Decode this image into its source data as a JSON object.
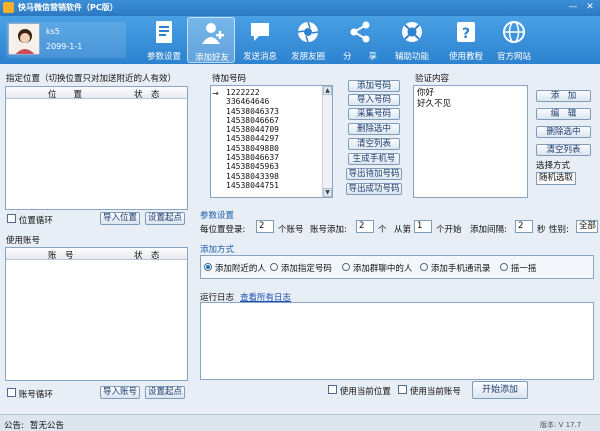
{
  "window": {
    "title": "快马微信营销软件（PC版）",
    "minimize": "—",
    "close": "✕"
  },
  "user": {
    "name": "ks5",
    "date": "2099-1-1"
  },
  "nav": [
    {
      "label": "参数设置",
      "icon": "document-icon"
    },
    {
      "label": "添加好友",
      "icon": "add-user-icon"
    },
    {
      "label": "发送消息",
      "icon": "chat-bubble-icon"
    },
    {
      "label": "发朋友圈",
      "icon": "camera-aperture-icon"
    },
    {
      "label": "分　　享",
      "icon": "share-icon"
    },
    {
      "label": "辅助功能",
      "icon": "lifebuoy-icon"
    },
    {
      "label": "使用教程",
      "icon": "help-icon"
    },
    {
      "label": "官方网站",
      "icon": "globe-icon"
    }
  ],
  "location": {
    "title": "指定位置（切换位置只对加送附近的人有效）",
    "col_position": "位　　置",
    "col_status": "状　态",
    "loop_label": "位置循环",
    "import_btn": "导入位置",
    "set_start_btn": "设置起点"
  },
  "account": {
    "title": "使用账号",
    "col_account": "账　号",
    "col_status": "状　态",
    "loop_label": "账号循环",
    "import_btn": "导入账号",
    "set_start_btn": "设置起点"
  },
  "pending": {
    "title": "待加号码",
    "numbers": [
      "1222222",
      "336464646",
      "14538046373",
      "14538046667",
      "14538044709",
      "14538044297",
      "14538049880",
      "14538046637",
      "14538045963",
      "14538043398",
      "14538044751"
    ],
    "buttons": [
      "添加号码",
      "导入号码",
      "采集号码",
      "删除选中",
      "清空列表",
      "生成手机号",
      "导出待加号码",
      "导出成功号码"
    ]
  },
  "verify": {
    "title": "验证内容",
    "lines": [
      "你好",
      "好久不见"
    ],
    "buttons": [
      "添　加",
      "编　辑",
      "删除选中",
      "清空列表"
    ],
    "method_label": "选择方式",
    "method_value": "随机选取"
  },
  "params": {
    "title": "参数设置",
    "per_location_label": "每位置登录:",
    "per_location_value": "2",
    "accounts_unit": "个账号",
    "account_add_label": "账号添加:",
    "account_add_value": "2",
    "count_unit": "个",
    "from_label": "从第",
    "from_value": "1",
    "start_label": "个开始",
    "interval_label": "添加间隔:",
    "interval_value": "2",
    "seconds_label": "秒",
    "gender_label": "性别:",
    "gender_value": "全部"
  },
  "method": {
    "title": "添加方式",
    "options": [
      "添加附近的人",
      "添加指定号码",
      "添加群聊中的人",
      "添加手机通讯录",
      "摇一摇"
    ],
    "selected": 0
  },
  "log": {
    "title": "运行日志",
    "view_all": "查看所有日志"
  },
  "bottom": {
    "use_location": "使用当前位置",
    "use_account": "使用当前账号",
    "start_btn": "开始添加"
  },
  "status": {
    "notice_label": "公告:",
    "notice_text": "暂无公告",
    "version": "版本: V 17.7"
  },
  "colors": {
    "header": "#2d82cf",
    "accent": "#1a5ea8"
  }
}
